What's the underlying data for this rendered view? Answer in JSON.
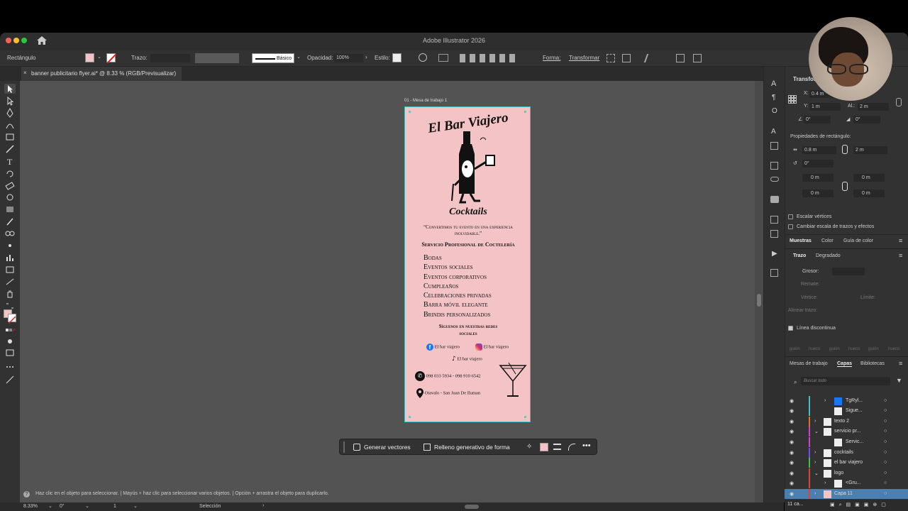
{
  "app": {
    "title": "Adobe Illustrator 2026"
  },
  "control_bar": {
    "object_type": "Rectángulo",
    "stroke_label": "Trazo:",
    "brush_label": "Básico",
    "opacity_label": "Opacidad:",
    "opacity_value": "100%",
    "style_label": "Estilo:",
    "shape_label": "Forma:",
    "transform_label": "Transformar"
  },
  "document_tab": {
    "title": "banner publicitario flyer.ai* @ 8.33 % (RGB/Previsualizar)"
  },
  "artboard": {
    "label": "01 - Mesa de trabajo 1",
    "brand": "El Bar Viajero",
    "subtitle": "Cocktails",
    "quote": "“Convertimos tu evento en una experiencia inolvidable.”",
    "service_heading": "Servicio Profesional de Coctelería",
    "services": [
      "Bodas",
      "Eventos sociales",
      "Eventos corporativos",
      "Cumpleaños",
      "Celebraciones privadas",
      "Barra móvil elegante",
      "Brindis personalizados"
    ],
    "follow": "Síguenos en nuestras redes sociales",
    "facebook": "El bar viajero",
    "instagram": "El bar viajero",
    "tiktok": "El bar viajero",
    "phone": "098 033 5934 - 098 910 6542",
    "location": "Otavalo - San Juan De Iluman"
  },
  "context_bar": {
    "generate_vectors": "Generar vectores",
    "generative_fill": "Relleno generativo de forma"
  },
  "hint_bar": {
    "text": "Haz clic en el objeto para seleccionar.  |  Mayús + haz clic para seleccionar varios objetos.  |  Opción + arrastra el objeto para duplicarlo."
  },
  "status_bar": {
    "zoom": "8.33%",
    "rotation": "0°",
    "artboard_num": "1",
    "tool": "Selección"
  },
  "transform_panel": {
    "title": "Transformar",
    "x": "0.4 m",
    "y": "1 m",
    "h": "2 m",
    "angle": "0°",
    "shear": "0°",
    "rect_props_label": "Propiedades de rectángulo:",
    "rect_w": "0.8 m",
    "rect_h": "2 m",
    "rect_angle": "0°",
    "corner1": "0 m",
    "corner2": "0 m",
    "corner3": "0 m",
    "corner4": "0 m",
    "scale_corners": "Escalar vértices",
    "scale_strokes": "Cambiar escala de trazos y efectos"
  },
  "swatch_tabs": [
    "Muestras",
    "Color",
    "Guía de color"
  ],
  "stroke_tabs": [
    "Trazo",
    "Degradado"
  ],
  "stroke_panel": {
    "weight_label": "Grosor:",
    "cap_label": "Remate:",
    "corner_label": "Vértice:",
    "limit_label": "Límite:",
    "align_label": "Alinear trazo:",
    "dashed_label": "Línea discontinua",
    "dash_labels": [
      "guión",
      "hueco",
      "guión",
      "hueco",
      "guión",
      "hueco"
    ]
  },
  "layers_tabs": [
    "Mesas de trabajo",
    "Capas",
    "Bibliotecas"
  ],
  "layers_panel": {
    "search_placeholder": "Buscar todo",
    "rows": [
      "TgRyl...",
      "Sigue...",
      "texto 2",
      "servicio pr...",
      "Servic...",
      "cocktails",
      "el bar viajero",
      "logo",
      "<Gru...",
      "Capa 11"
    ],
    "footer_count": "11 ca..."
  },
  "colors": {
    "artboard_pink": "#f4c3c6",
    "accent_blue": "#4a7fb0",
    "selection_cyan": "#45c0c0"
  }
}
